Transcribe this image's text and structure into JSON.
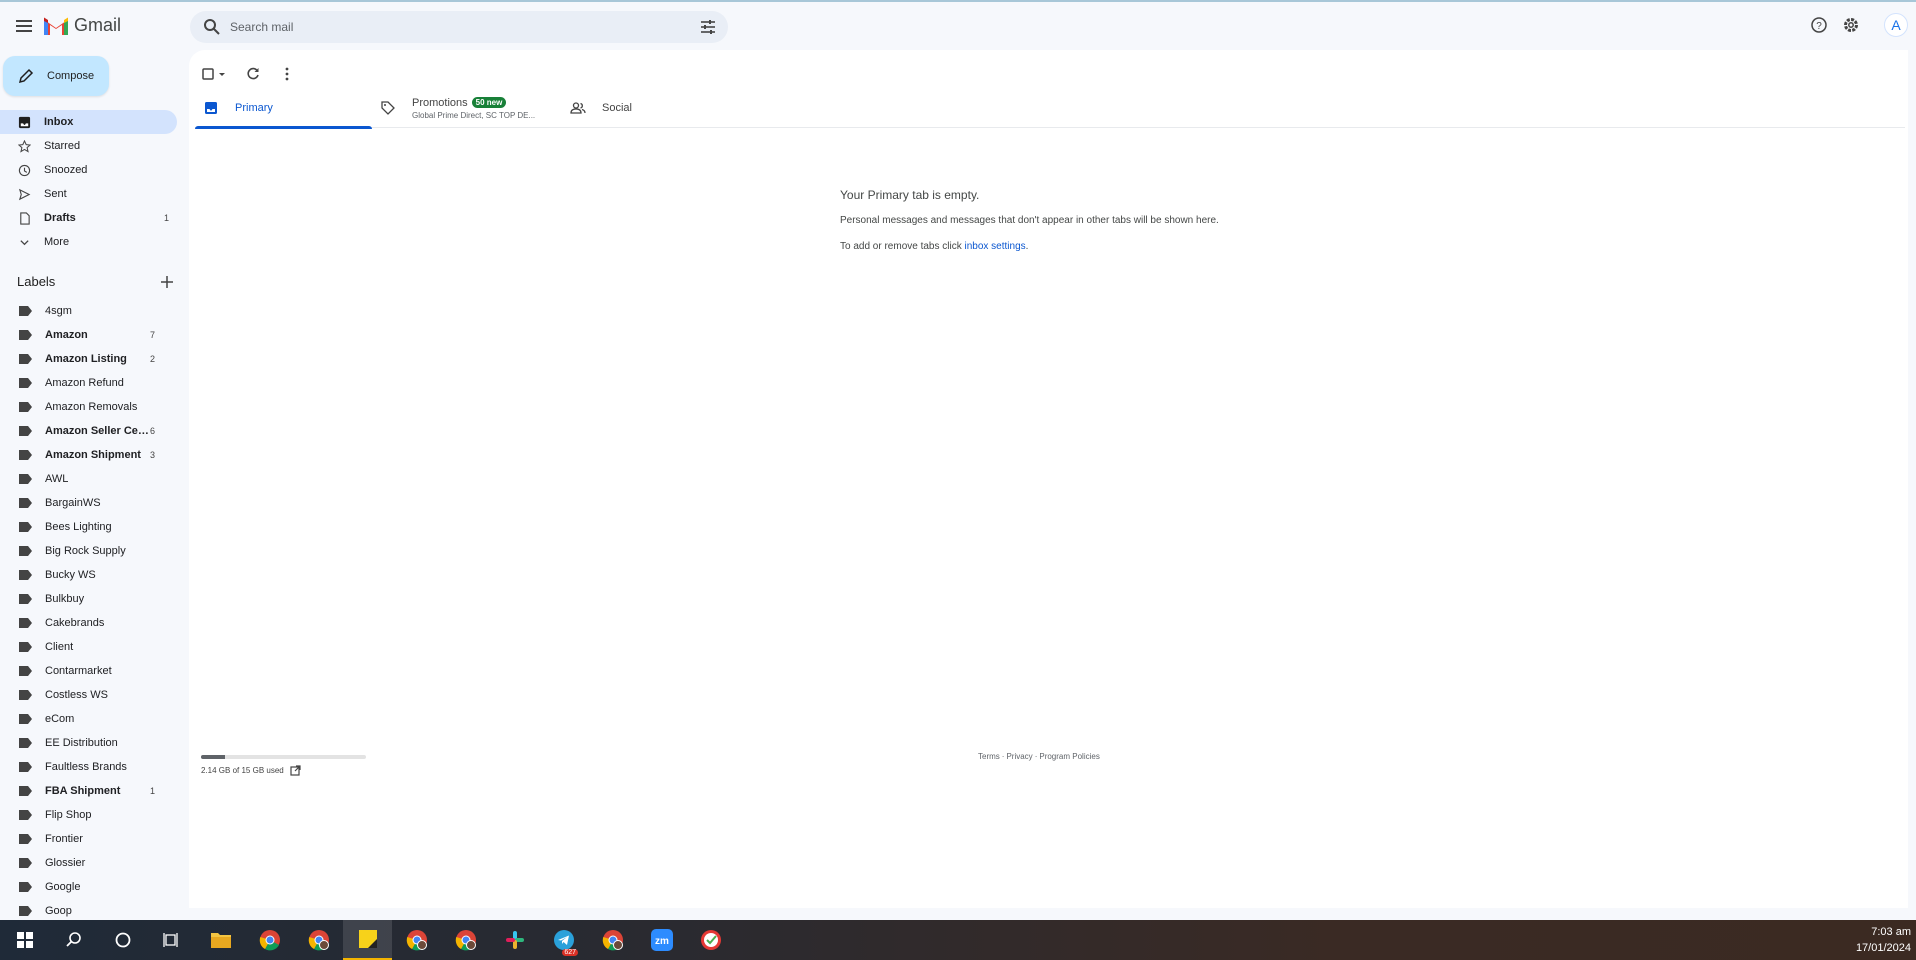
{
  "app": {
    "name": "Gmail"
  },
  "search": {
    "placeholder": "Search mail"
  },
  "header": {
    "avatar_letter": "A"
  },
  "compose": {
    "label": "Compose"
  },
  "nav": [
    {
      "label": "Inbox",
      "count": "",
      "icon": "inbox-icon",
      "active": true
    },
    {
      "label": "Starred",
      "count": "",
      "icon": "star-icon"
    },
    {
      "label": "Snoozed",
      "count": "",
      "icon": "clock-icon"
    },
    {
      "label": "Sent",
      "count": "",
      "icon": "send-icon"
    },
    {
      "label": "Drafts",
      "count": "1",
      "icon": "draft-icon",
      "bold": true
    },
    {
      "label": "More",
      "count": "",
      "icon": "chevron-down-icon"
    }
  ],
  "labels_section": {
    "title": "Labels"
  },
  "labels": [
    {
      "name": "4sgm",
      "count": ""
    },
    {
      "name": "Amazon",
      "count": "7",
      "bold": true
    },
    {
      "name": "Amazon Listing",
      "count": "2",
      "bold": true
    },
    {
      "name": "Amazon Refund",
      "count": ""
    },
    {
      "name": "Amazon Removals",
      "count": ""
    },
    {
      "name": "Amazon Seller Cen...",
      "count": "6",
      "bold": true
    },
    {
      "name": "Amazon Shipment",
      "count": "3",
      "bold": true
    },
    {
      "name": "AWL",
      "count": ""
    },
    {
      "name": "BargainWS",
      "count": ""
    },
    {
      "name": "Bees Lighting",
      "count": ""
    },
    {
      "name": "Big Rock Supply",
      "count": ""
    },
    {
      "name": "Bucky WS",
      "count": ""
    },
    {
      "name": "Bulkbuy",
      "count": ""
    },
    {
      "name": "Cakebrands",
      "count": ""
    },
    {
      "name": "Client",
      "count": ""
    },
    {
      "name": "Contarmarket",
      "count": ""
    },
    {
      "name": "Costless WS",
      "count": ""
    },
    {
      "name": "eCom",
      "count": ""
    },
    {
      "name": "EE Distribution",
      "count": ""
    },
    {
      "name": "Faultless Brands",
      "count": ""
    },
    {
      "name": "FBA Shipment",
      "count": "1",
      "bold": true
    },
    {
      "name": "Flip Shop",
      "count": ""
    },
    {
      "name": "Frontier",
      "count": ""
    },
    {
      "name": "Glossier",
      "count": ""
    },
    {
      "name": "Google",
      "count": ""
    },
    {
      "name": "Goop",
      "count": ""
    }
  ],
  "tabs": {
    "primary": "Primary",
    "promotions": "Promotions",
    "promotions_badge": "50 new",
    "promotions_sub": "Global Prime Direct, SC TOP DE...",
    "social": "Social"
  },
  "empty_state": {
    "title": "Your Primary tab is empty.",
    "description": "Personal messages and messages that don't appear in other tabs will be shown here.",
    "settings_prefix": "To add or remove tabs click ",
    "settings_link": "inbox settings",
    "settings_suffix": "."
  },
  "storage": {
    "text": "2.14 GB of 15 GB used",
    "fraction": 0.143
  },
  "footer": {
    "terms": "Terms",
    "sep": "·",
    "privacy": "Privacy",
    "policies": "Program Policies"
  },
  "taskbar": {
    "apps": [
      "start-icon",
      "search-icon",
      "cortana-icon",
      "task-view-icon",
      "file-explorer-icon",
      "chrome-icon",
      "chrome-profile-icon",
      "sticky-notes-icon",
      "chrome-profile-icon",
      "chrome-profile-icon",
      "slack-icon",
      "telegram-icon",
      "chrome-profile-icon",
      "zoom-icon",
      "ticktick-icon"
    ],
    "telegram_badge": "627",
    "time": "7:03 am",
    "date": "17/01/2024"
  }
}
